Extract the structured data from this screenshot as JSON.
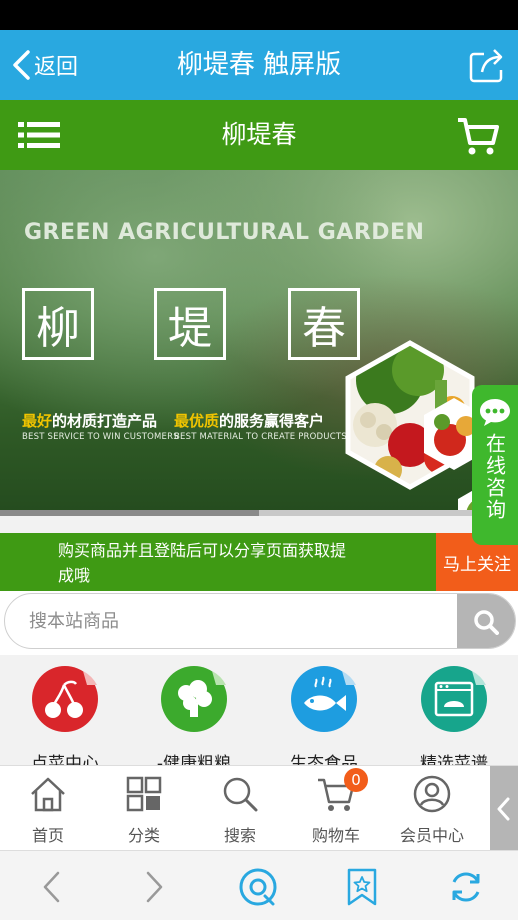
{
  "browser_header": {
    "back_label": "返回",
    "title": "柳堤春 触屏版"
  },
  "site_header": {
    "title": "柳堤春"
  },
  "banner": {
    "headline": "GREEN AGRICULTURAL GARDEN",
    "chars": [
      "柳",
      "堤",
      "春"
    ],
    "slogan_left_highlight": "最好",
    "slogan_left_rest": "的材质打造产品",
    "slogan_right_highlight": "最优质",
    "slogan_right_rest": "的服务赢得客户",
    "slogan_right_prefix": "最优质",
    "english_left": "BEST SERVICE TO WIN CUSTOMERS",
    "english_right": "BEST MATERIAL TO CREATE PRODUCTS",
    "progress_fraction": 0.5
  },
  "consult_tab": {
    "label": "在线咨询"
  },
  "share_notice": {
    "text": "购买商品并且登陆后可以分享页面获取提成哦",
    "follow_label": "马上关注"
  },
  "search": {
    "placeholder": "搜本站商品"
  },
  "categories": [
    {
      "label": "点菜中心",
      "icon": "cherry-icon",
      "color": "#d9262b"
    },
    {
      "label": "-健康粗粮",
      "icon": "broccoli-icon",
      "color": "#3caa2d"
    },
    {
      "label": "生态食品",
      "icon": "fish-icon",
      "color": "#1e9de0"
    },
    {
      "label": "精选菜谱",
      "icon": "oven-icon",
      "color": "#17a58c"
    }
  ],
  "bottom_nav": {
    "items": [
      {
        "label": "首页",
        "icon": "home-icon"
      },
      {
        "label": "分类",
        "icon": "grid-icon"
      },
      {
        "label": "搜索",
        "icon": "search-icon"
      },
      {
        "label": "购物车",
        "icon": "cart-icon"
      },
      {
        "label": "会员中心",
        "icon": "user-icon"
      }
    ],
    "cart_count": "0"
  },
  "colors": {
    "browser_blue": "#29a8e0",
    "brand_green": "#3f9a14",
    "accent_orange": "#f25d1a",
    "consult_green": "#3fb82d"
  }
}
